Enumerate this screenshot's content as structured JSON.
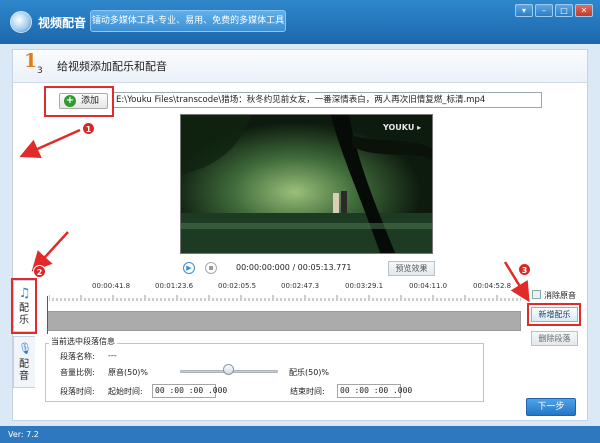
{
  "window": {
    "title": "视频配音",
    "slogan": "镭动多媒体工具-专业、易用、免费的多媒体工具",
    "controls": [
      "dropdown",
      "minimize",
      "maximize",
      "close"
    ]
  },
  "step": {
    "current": "1",
    "total": "3",
    "title": "给视频添加配乐和配音"
  },
  "file": {
    "add_label": "添加",
    "path": "E:\\Youku Files\\transcode\\猎场：秋冬约见前女友，一番深情表白，两人再次旧情复燃_标清.mp4"
  },
  "video": {
    "watermark": "YOUKU ▸"
  },
  "playback": {
    "current_time": "00:00:00:000",
    "duration": "00:05:13.771",
    "readout": "00:00:00:000  /  00:05:13.771",
    "preview_label": "预览效果"
  },
  "tabs": [
    {
      "label": "配乐",
      "icon": "music-note-icon"
    },
    {
      "label": "配音",
      "icon": "microphone-icon"
    }
  ],
  "timeline": {
    "ruler": [
      "00:00:41.8",
      "00:01:23.6",
      "00:02:05.5",
      "00:02:47.3",
      "00:03:29.1",
      "00:04:11.0",
      "00:04:52.8"
    ]
  },
  "right_panel": {
    "mute_label": "消除原音",
    "new_music_label": "新增配乐",
    "delete_label": "删除段落"
  },
  "segment": {
    "group_title": "当前选中段落信息",
    "name_label": "段落名称:",
    "name_value": "---",
    "volume_label": "音量比例:",
    "original_label": "原音(50)%",
    "music_label": "配乐(50)%",
    "volume_ratio": 0.5,
    "time_label": "段落时间:",
    "start_label": "起始时间:",
    "start_value": "00 :00 :00 .000",
    "end_label": "结束时间:",
    "end_value": "00 :00 :00 .000"
  },
  "next_label": "下一步",
  "version": "Ver: 7.2",
  "annotations": [
    "1",
    "2",
    "3"
  ],
  "colors": {
    "titlebar": "#1c67ad",
    "accent": "#2a7fd0",
    "annotation_red": "#e12b2b",
    "step_orange": "#e07b1f"
  }
}
